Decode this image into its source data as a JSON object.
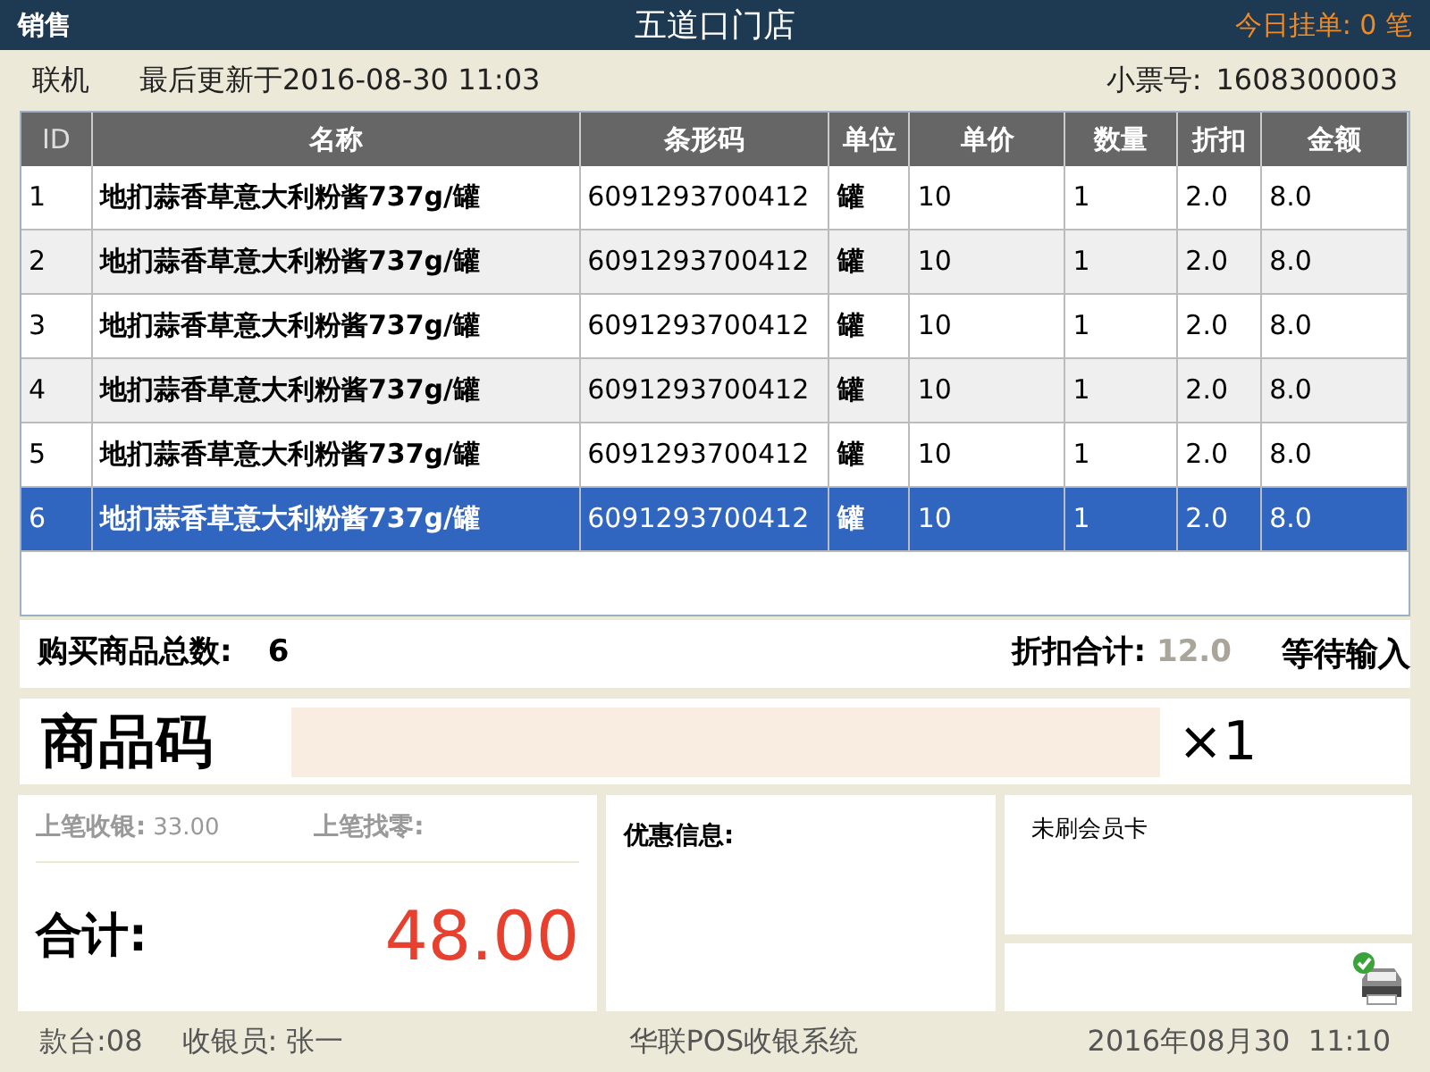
{
  "header": {
    "mode": "销售",
    "store": "五道口门店",
    "pending": "今日挂单: 0 笔"
  },
  "info_bar": {
    "connection": "联机",
    "last_update": "最后更新于2016-08-30 11:03",
    "receipt_label": "小票号:",
    "receipt_no": "1608300003"
  },
  "table": {
    "columns": [
      "ID",
      "名称",
      "条形码",
      "单位",
      "单价",
      "数量",
      "折扣",
      "金额"
    ],
    "rows": [
      {
        "cells": [
          "1",
          "地扪蒜香草意大利粉酱737g/罐",
          "6091293700412",
          "罐",
          "10",
          "1",
          "2.0",
          "8.0"
        ],
        "selected": false
      },
      {
        "cells": [
          "2",
          "地扪蒜香草意大利粉酱737g/罐",
          "6091293700412",
          "罐",
          "10",
          "1",
          "2.0",
          "8.0"
        ],
        "selected": false
      },
      {
        "cells": [
          "3",
          "地扪蒜香草意大利粉酱737g/罐",
          "6091293700412",
          "罐",
          "10",
          "1",
          "2.0",
          "8.0"
        ],
        "selected": false
      },
      {
        "cells": [
          "4",
          "地扪蒜香草意大利粉酱737g/罐",
          "6091293700412",
          "罐",
          "10",
          "1",
          "2.0",
          "8.0"
        ],
        "selected": false
      },
      {
        "cells": [
          "5",
          "地扪蒜香草意大利粉酱737g/罐",
          "6091293700412",
          "罐",
          "10",
          "1",
          "2.0",
          "8.0"
        ],
        "selected": false
      },
      {
        "cells": [
          "6",
          "地扪蒜香草意大利粉酱737g/罐",
          "6091293700412",
          "罐",
          "10",
          "1",
          "2.0",
          "8.0"
        ],
        "selected": true
      }
    ]
  },
  "summary": {
    "count_label": "购买商品总数:",
    "count": "6",
    "discount_label": "折扣合计:",
    "discount": "12.0",
    "status": "等待输入"
  },
  "code_entry": {
    "label": "商品码",
    "multiplier": "×1"
  },
  "payment": {
    "last_paid_label": "上笔收银:",
    "last_paid": "33.00",
    "last_change_label": "上笔找零:",
    "total_label": "合计:",
    "total": "48.00"
  },
  "promo": {
    "label": "优惠信息:"
  },
  "member": {
    "text": "未刷会员卡"
  },
  "status_bar": {
    "terminal": "款台:08",
    "cashier": "收银员: 张一",
    "system": "华联POS收银系统",
    "datetime": "2016年08月30  11:10"
  }
}
